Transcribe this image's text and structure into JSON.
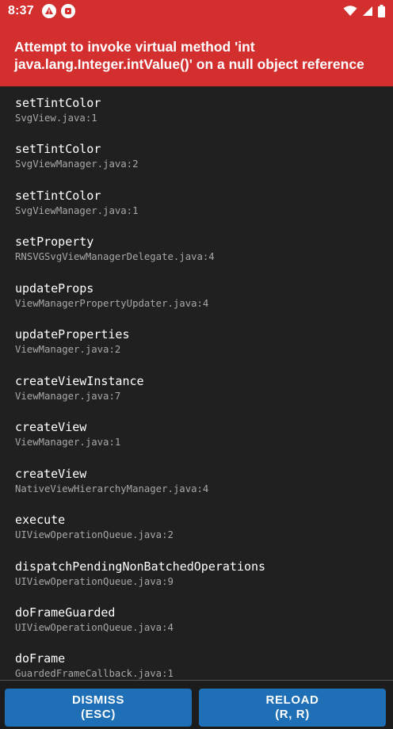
{
  "status_bar": {
    "time": "8:37",
    "left_icons": [
      "warning-icon",
      "app-icon"
    ],
    "right_icons": [
      "wifi-icon",
      "signal-icon",
      "battery-icon"
    ]
  },
  "error": {
    "message": "Attempt to invoke virtual method 'int java.lang.Integer.intValue()' on a null object reference"
  },
  "stack_frames": [
    {
      "method": "setTintColor",
      "file": "SvgView.java:1"
    },
    {
      "method": "setTintColor",
      "file": "SvgViewManager.java:2"
    },
    {
      "method": "setTintColor",
      "file": "SvgViewManager.java:1"
    },
    {
      "method": "setProperty",
      "file": "RNSVGSvgViewManagerDelegate.java:4"
    },
    {
      "method": "updateProps",
      "file": "ViewManagerPropertyUpdater.java:4"
    },
    {
      "method": "updateProperties",
      "file": "ViewManager.java:2"
    },
    {
      "method": "createViewInstance",
      "file": "ViewManager.java:7"
    },
    {
      "method": "createView",
      "file": "ViewManager.java:1"
    },
    {
      "method": "createView",
      "file": "NativeViewHierarchyManager.java:4"
    },
    {
      "method": "execute",
      "file": "UIViewOperationQueue.java:2"
    },
    {
      "method": "dispatchPendingNonBatchedOperations",
      "file": "UIViewOperationQueue.java:9"
    },
    {
      "method": "doFrameGuarded",
      "file": "UIViewOperationQueue.java:4"
    },
    {
      "method": "doFrame",
      "file": "GuardedFrameCallback.java:1"
    }
  ],
  "buttons": {
    "dismiss_label": "DISMISS",
    "dismiss_shortcut": "(ESC)",
    "reload_label": "RELOAD",
    "reload_shortcut": "(R, R)"
  },
  "colors": {
    "header_red": "#d32f2f",
    "background": "#202020",
    "button_blue": "#1e6fb5",
    "file_text_gray": "#a8a8a8"
  }
}
